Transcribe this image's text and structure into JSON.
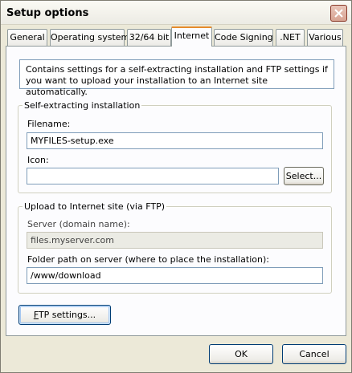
{
  "window": {
    "title": "Setup options"
  },
  "tabs": [
    {
      "label": "General"
    },
    {
      "label": "Operating system"
    },
    {
      "label": "32/64 bit"
    },
    {
      "label": "Internet"
    },
    {
      "label": "Code Signing"
    },
    {
      "label": ".NET"
    },
    {
      "label": "Various"
    }
  ],
  "active_tab": "Internet",
  "info_text": "Contains settings for a self-extracting installation and FTP settings if you want to upload your installation to an Internet site automatically.",
  "self_extracting": {
    "legend": "Self-extracting installation",
    "filename_label": "Filename:",
    "filename_value": "MYFILES-setup.exe",
    "icon_label": "Icon:",
    "icon_value": "",
    "select_button": "Select..."
  },
  "upload": {
    "legend": "Upload to Internet site (via FTP)",
    "server_label": "Server (domain name):",
    "server_value": "files.myserver.com",
    "folder_label": "Folder path on server (where to place the installation):",
    "folder_value": "/www/download"
  },
  "ftp_settings_button": {
    "accel": "F",
    "rest": "TP settings..."
  },
  "ok_button": "OK",
  "cancel_button": "Cancel",
  "colors": {
    "tab_highlight": "#e68b2c",
    "field_border": "#7f9db9",
    "window_bg": "#ece9d8"
  }
}
